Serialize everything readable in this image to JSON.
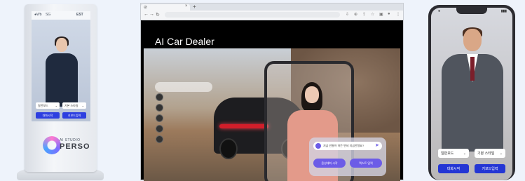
{
  "kiosk": {
    "logos": [
      "●Wb",
      "SG",
      "EST"
    ],
    "select_left": "일반모드",
    "select_right": "기본 스타일",
    "btn_left": "대화시작",
    "btn_right": "키보드입력",
    "brand_small": "AI STUDIO",
    "brand_big": "PERSO"
  },
  "browser": {
    "page_title": "AI Car Dealer",
    "chat_placeholder": "지금 만들어 하든 변세 지금만형요?",
    "chat_btn_left": "음성대화 시작",
    "chat_btn_right": "텍스트 입력"
  },
  "phone": {
    "select_left": "일반모드",
    "select_right": "기본 스타일",
    "btn_left": "대화시작",
    "btn_right": "키보드입력"
  }
}
